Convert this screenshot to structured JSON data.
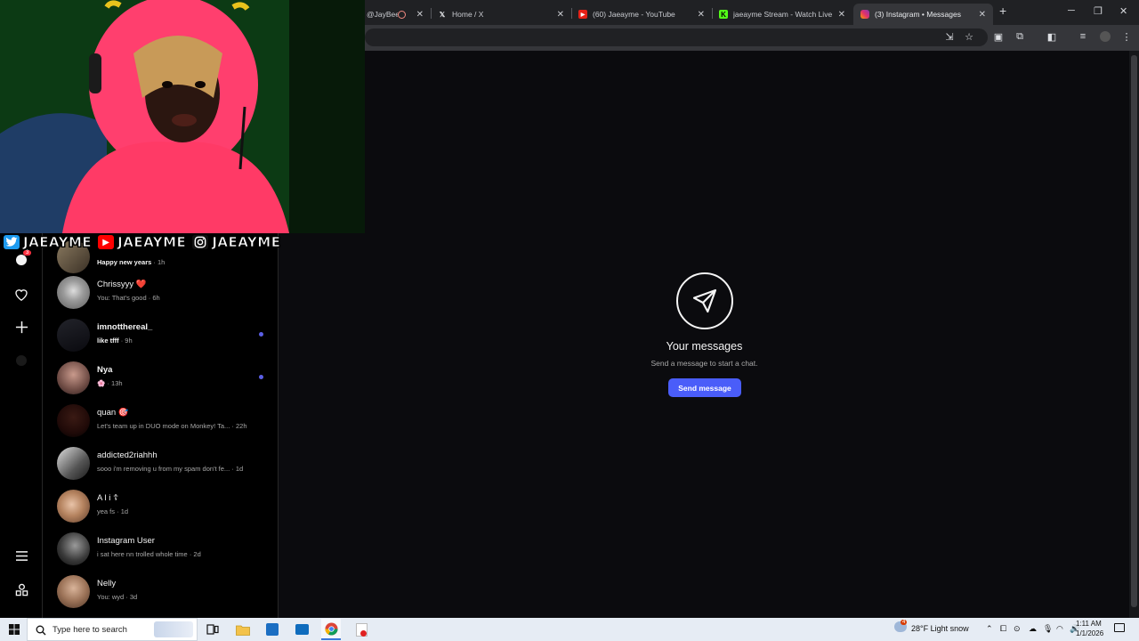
{
  "browser": {
    "tabs": [
      {
        "title": "@JayBeen",
        "favicon": "record-icon"
      },
      {
        "title": "Home / X",
        "favicon": "x-icon"
      },
      {
        "title": "(60) Jaeayme - YouTube",
        "favicon": "youtube-icon"
      },
      {
        "title": "jaeayme Stream - Watch Live o",
        "favicon": "kick-icon"
      },
      {
        "title": "(3) Instagram • Messages",
        "favicon": "instagram-icon",
        "active": true
      }
    ],
    "new_tab_glyph": "+"
  },
  "nav": {
    "notification_badge": "3"
  },
  "conversations": [
    {
      "name": "",
      "preview": "Happy new years",
      "time": "· 1h",
      "unread": true
    },
    {
      "name": "Chrissyyy ❤️",
      "preview": "You: That's good",
      "time": "· 6h",
      "unread": false
    },
    {
      "name": "imnotthereal_",
      "preview": "like tfff",
      "time": "· 9h",
      "unread": true
    },
    {
      "name": "Nya",
      "preview": "🌸",
      "time": "· 13h",
      "unread": true
    },
    {
      "name": "quan 🎯",
      "preview": "Let's team up in DUO mode on Monkey! Ta...",
      "time": "· 22h",
      "unread": false
    },
    {
      "name": "addicted2riahhh",
      "preview": "sooo i'm removing u from my spam don't fe...",
      "time": "· 1d",
      "unread": false
    },
    {
      "name": "A l i ☦",
      "preview": "yea fs",
      "time": "· 1d",
      "unread": false
    },
    {
      "name": "Instagram User",
      "preview": "i sat here nn trolled whole time",
      "time": "· 2d",
      "unread": false
    },
    {
      "name": "Nelly",
      "preview": "You: wyd",
      "time": "· 3d",
      "unread": false
    }
  ],
  "main": {
    "title": "Your messages",
    "subtitle": "Send a message to start a chat.",
    "button": "Send message"
  },
  "overlay": {
    "handles": [
      "JAEAYME",
      "JAEAYME",
      "JAEAYME"
    ]
  },
  "taskbar": {
    "search_placeholder": "Type here to search",
    "weather": "28°F  Light snow",
    "weather_badge": "4",
    "time": "1:11 AM",
    "date": "1/1/2026"
  },
  "colors": {
    "accent": "#4a5df9",
    "unread_dot": "#5b5fe6",
    "background": "#0b0b0e"
  }
}
